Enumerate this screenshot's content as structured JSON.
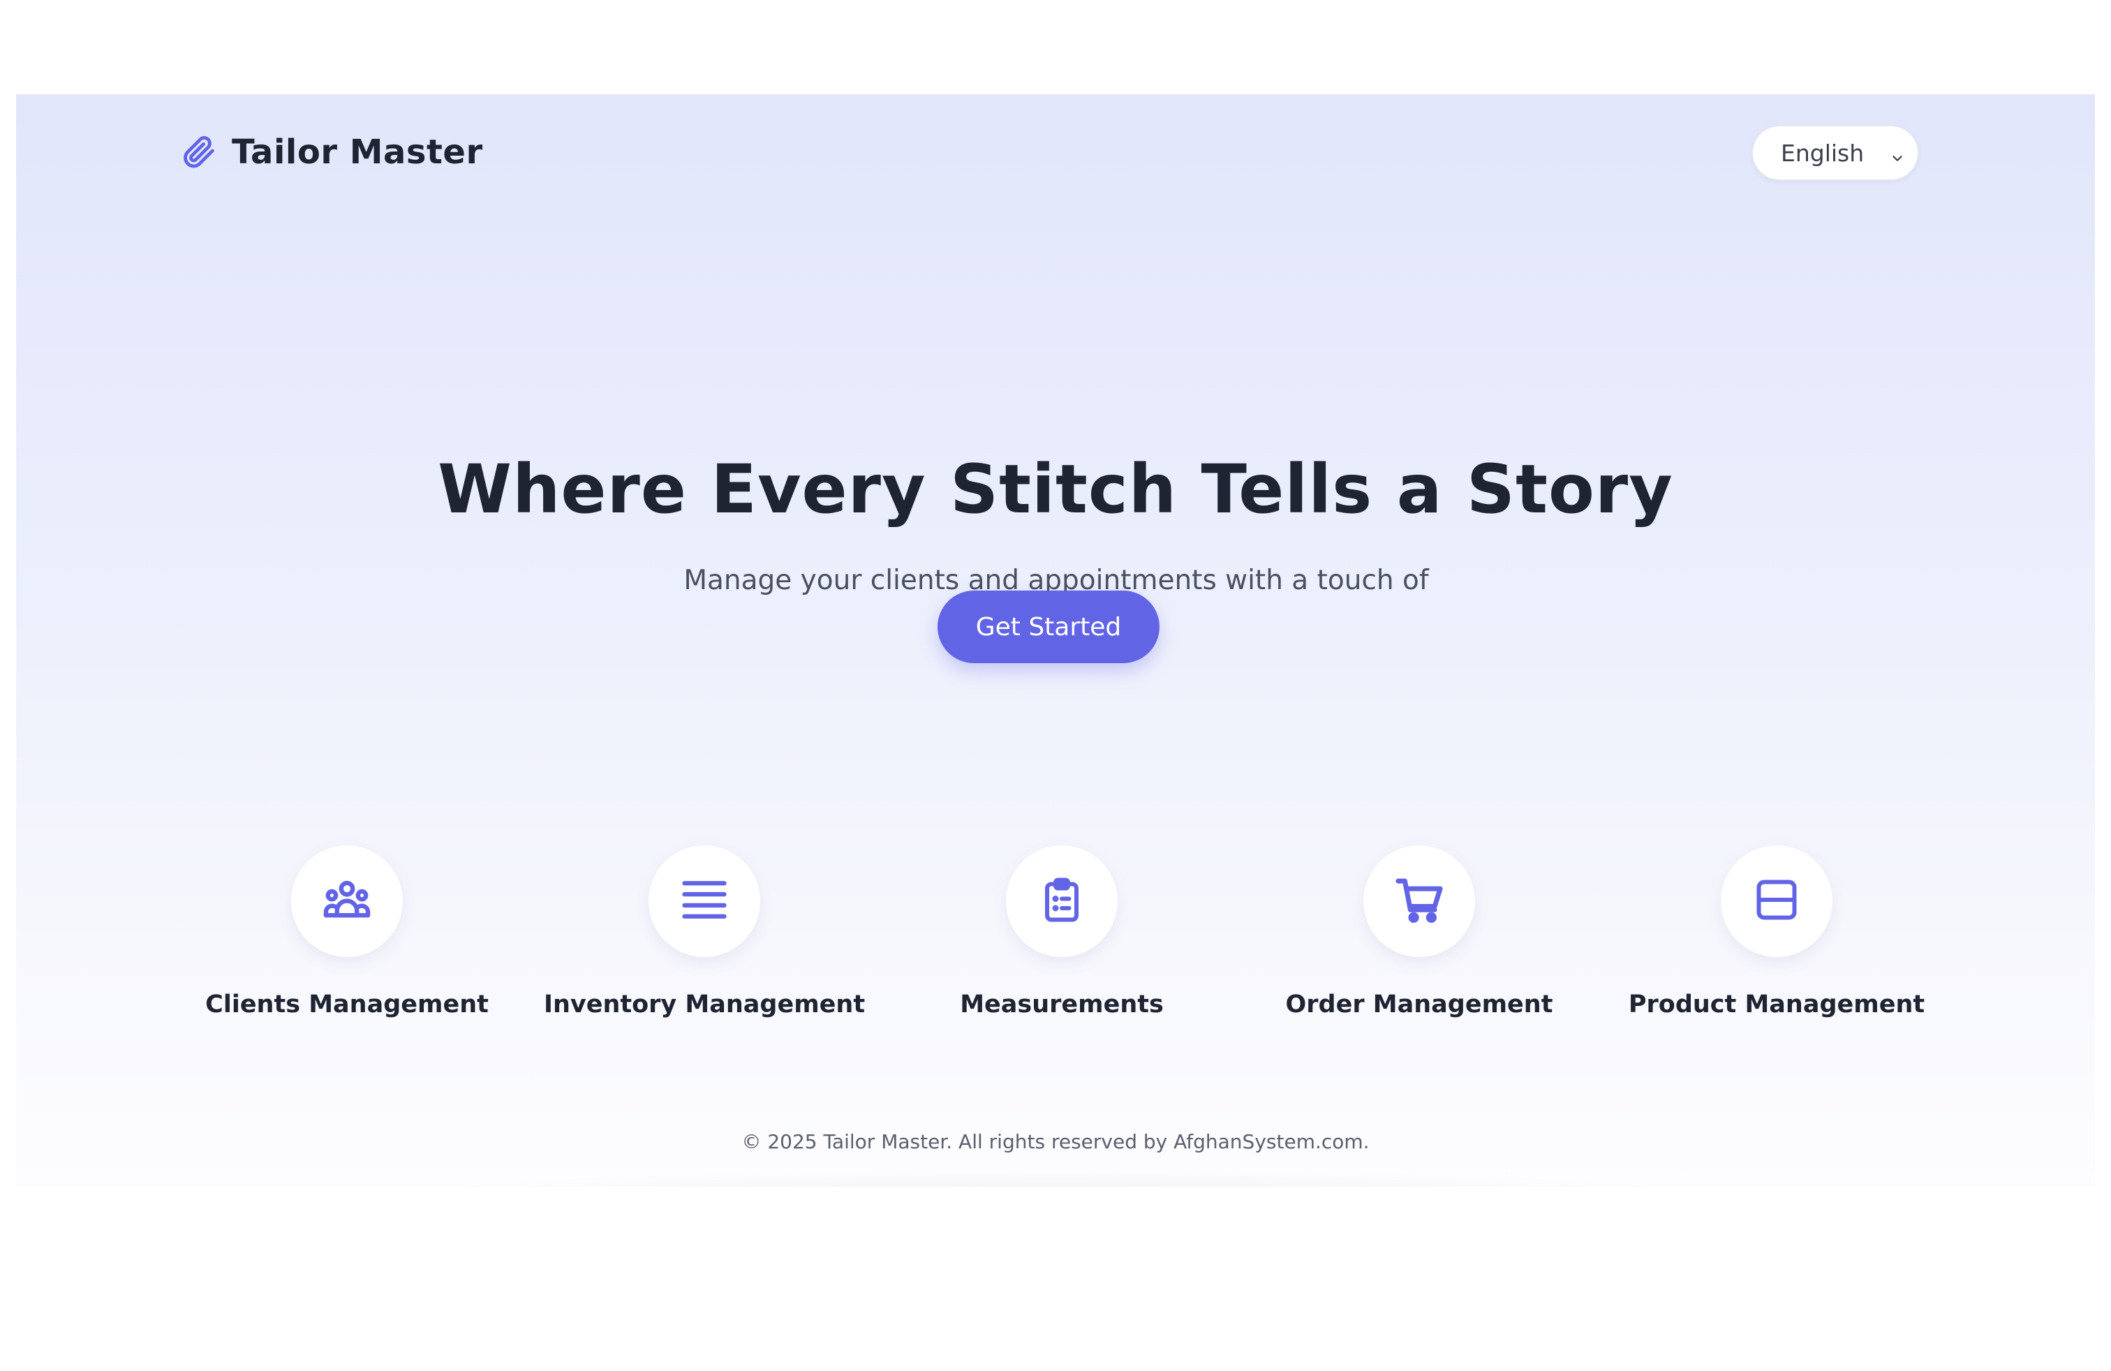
{
  "brand": {
    "name": "Tailor Master",
    "icon": "paperclip-icon",
    "accent_color": "#6264e6"
  },
  "language_select": {
    "selected": "English"
  },
  "hero": {
    "title": "Where Every Stitch Tells a Story",
    "subtitle": "Manage your clients and appointments with a touch of cuteness!",
    "cta_label": "Get Started"
  },
  "features": [
    {
      "label": "Clients Management",
      "icon": "users-group-icon"
    },
    {
      "label": "Inventory Management",
      "icon": "list-lines-icon"
    },
    {
      "label": "Measurements",
      "icon": "clipboard-list-icon"
    },
    {
      "label": "Order Management",
      "icon": "shopping-cart-icon"
    },
    {
      "label": "Product Management",
      "icon": "layout-rows-icon"
    }
  ],
  "footer": {
    "text": "© 2025 Tailor Master. All rights reserved by AfghanSystem.com."
  }
}
